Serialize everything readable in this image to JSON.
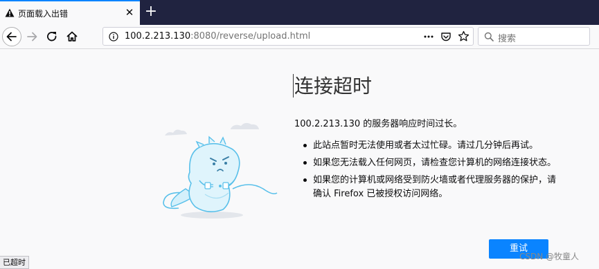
{
  "tab": {
    "title": "页面载入出错",
    "close_glyph": "✕",
    "warning_icon": "warning-triangle-icon"
  },
  "new_tab_glyph": "+",
  "nav": {
    "url_host": "100.2.213.130",
    "url_rest": ":8080/reverse/upload.html",
    "more_glyph": "•••",
    "search_placeholder": "搜索"
  },
  "error": {
    "title": "连接超时",
    "description": "100.2.213.130 的服务器响应时间过长。",
    "bullets": [
      "此站点暂时无法使用或者太过忙碌。请过几分钟后再试。",
      "如果您无法载入任何网页，请检查您计算机的网络连接状态。",
      "如果您的计算机或网络受到防火墙或者代理服务器的保护，请确认 Firefox 已被授权访问网络。"
    ],
    "retry_label": "重试"
  },
  "status_text": "已超时",
  "watermark": "CSDN @牧童人",
  "colors": {
    "accent": "#0a84ff",
    "tabstrip": "#202340",
    "background": "#f9f9fa"
  }
}
